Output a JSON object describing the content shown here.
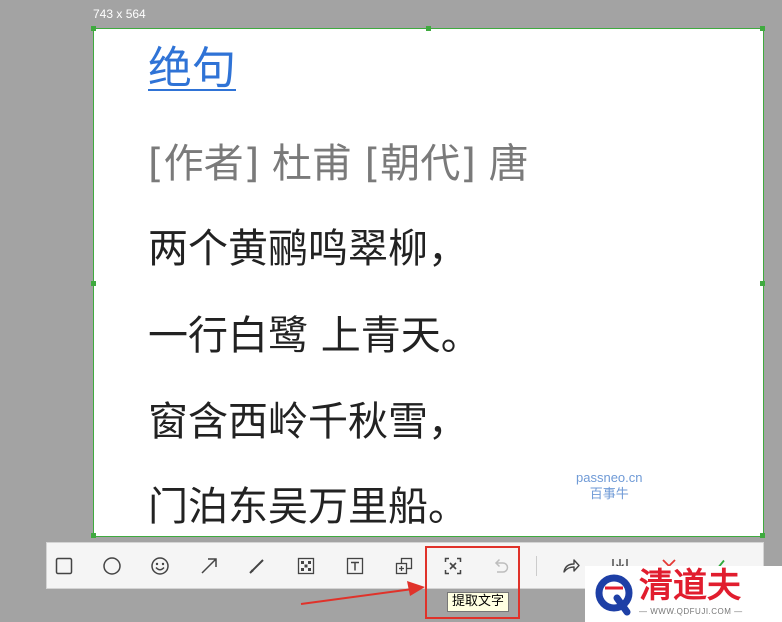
{
  "selection": {
    "size_label": "743 x 564"
  },
  "document": {
    "title": "绝句",
    "byline": "[作者] 杜甫 [朝代]  唐",
    "lines": [
      "两个黄鹂鸣翠柳，",
      "一行白鹭 上青天。",
      "窗含西岭千秋雪，",
      "门泊东吴万里船。"
    ],
    "watermark": {
      "site": "passneo.cn",
      "name": "百事牛"
    }
  },
  "toolbar": {
    "tools": [
      {
        "id": "rectangle",
        "icon": "rectangle-icon"
      },
      {
        "id": "ellipse",
        "icon": "ellipse-icon"
      },
      {
        "id": "emoji",
        "icon": "smiley-icon"
      },
      {
        "id": "arrow",
        "icon": "arrow-icon"
      },
      {
        "id": "pen",
        "icon": "pen-icon"
      },
      {
        "id": "mosaic",
        "icon": "mosaic-icon"
      },
      {
        "id": "text",
        "icon": "text-icon"
      },
      {
        "id": "pin",
        "icon": "pin-icon"
      },
      {
        "id": "extract-text",
        "icon": "extract-text-icon"
      },
      {
        "id": "undo",
        "icon": "undo-icon"
      },
      {
        "id": "share",
        "icon": "share-icon"
      },
      {
        "id": "save",
        "icon": "download-icon"
      },
      {
        "id": "cancel",
        "icon": "close-icon"
      },
      {
        "id": "confirm",
        "icon": "check-icon"
      }
    ],
    "tooltip": "提取文字"
  },
  "colors": {
    "selection_border": "#3faa3f",
    "title_link": "#2f73d6",
    "annotation": "#e0322a",
    "cancel": "#e53935",
    "confirm": "#2eaa3a"
  },
  "brand": {
    "name": "清道夫",
    "url": "— WWW.QDFUJI.COM —"
  }
}
